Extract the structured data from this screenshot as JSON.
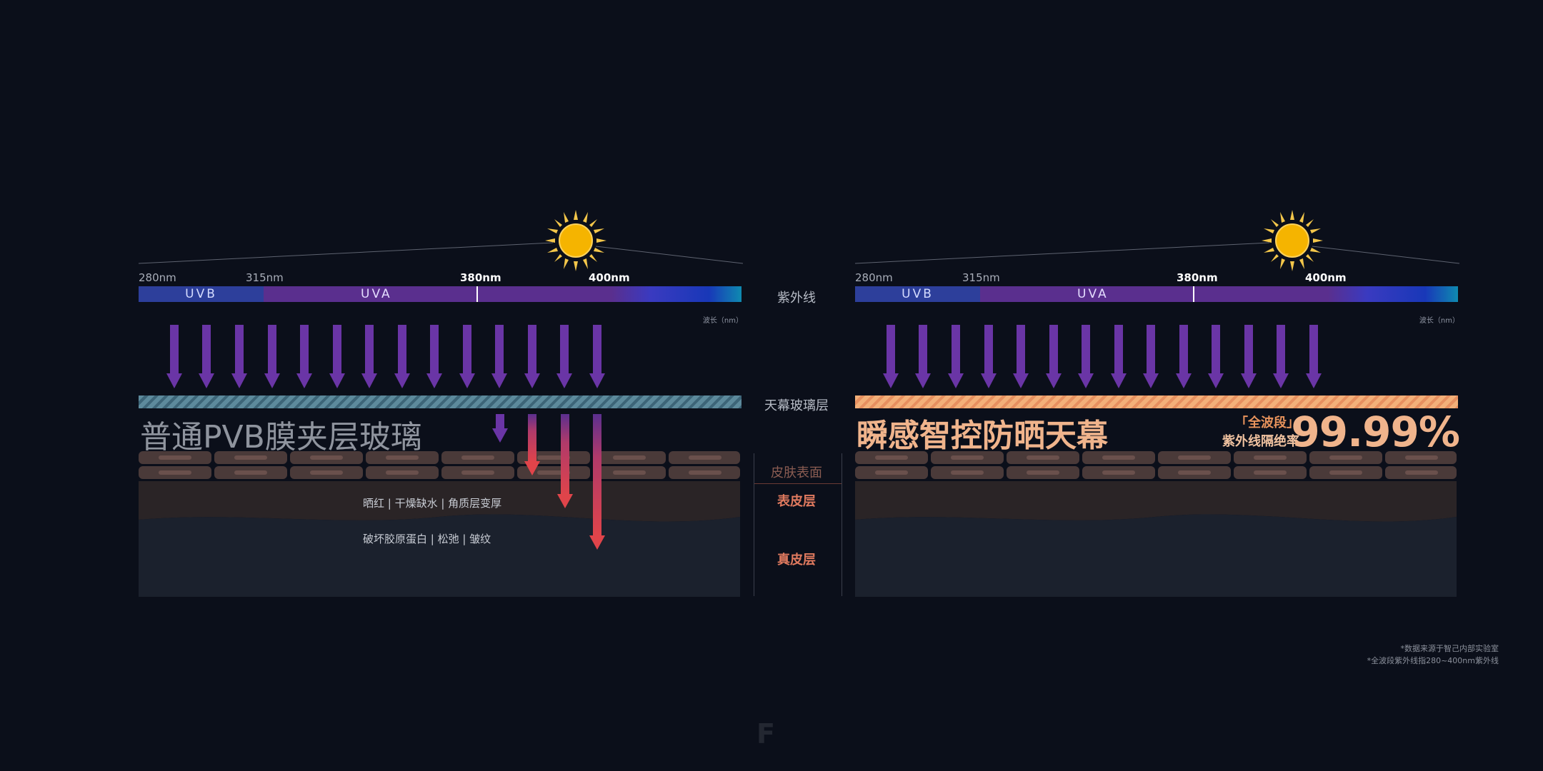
{
  "spectrum": {
    "tick_labels": [
      "280nm",
      "315nm",
      "380nm",
      "400nm"
    ],
    "band_uvb": "UVB",
    "band_uva": "UVA",
    "unit": "波长（nm）"
  },
  "side_labels": {
    "uv": "紫外线",
    "glass": "天幕玻璃层",
    "skin_surface": "皮肤表面",
    "epidermis": "表皮层",
    "dermis": "真皮层"
  },
  "left_panel": {
    "title": "普通PVB膜夹层玻璃",
    "epidermis_effects": "晒红 | 干燥缺水 | 角质层变厚",
    "dermis_effects": "破坏胶原蛋白 | 松弛 | 皱纹"
  },
  "right_panel": {
    "title": "瞬感智控防晒天幕",
    "badge_line1": "「全波段」",
    "badge_line2": "紫外线隔绝率",
    "rate": "99.99%"
  },
  "footnotes": {
    "line1": "*数据来源于智己内部实验室",
    "line2": "*全波段紫外线指280~400nm紫外线"
  },
  "watermark": "F",
  "colors": {
    "background": "#0b0f1a",
    "uvb": "#2d3f9b",
    "uva": "#5a2f8e",
    "uv_arrow": "#6a35a6",
    "penetrating_arrow": "#e0444a",
    "skin_label": "#e07a5f",
    "accent_orange": "#f0b48c",
    "glass_normal": "#5d8a9c",
    "glass_smart": "#f3b079"
  }
}
